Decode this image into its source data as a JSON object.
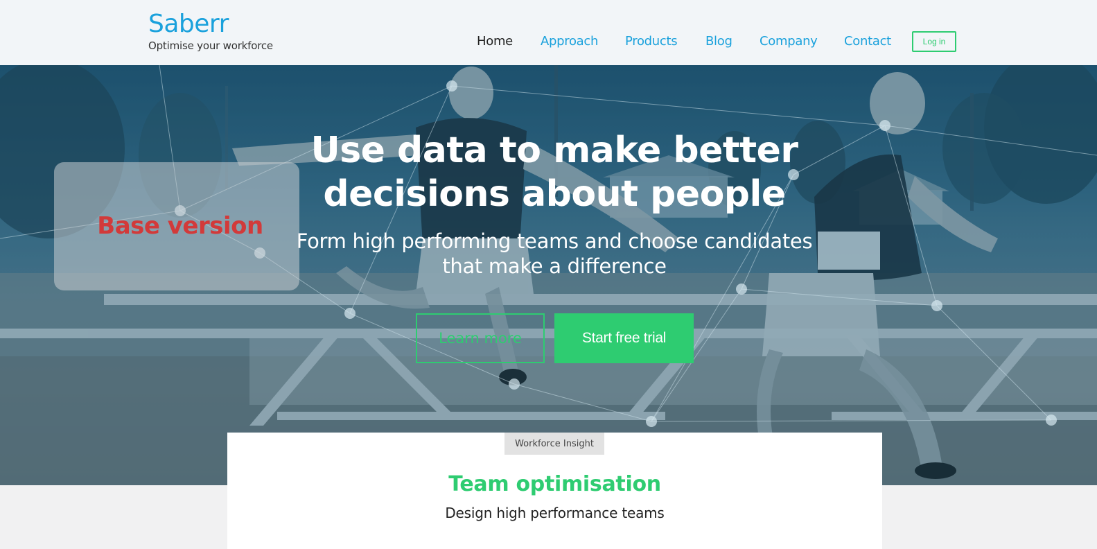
{
  "header": {
    "brand_name": "Saberr",
    "tagline": "Optimise your workforce",
    "nav": [
      {
        "label": "Home",
        "active": true
      },
      {
        "label": "Approach",
        "active": false
      },
      {
        "label": "Products",
        "active": false
      },
      {
        "label": "Blog",
        "active": false
      },
      {
        "label": "Company",
        "active": false
      },
      {
        "label": "Contact",
        "active": false
      }
    ],
    "login_label": "Log in"
  },
  "hero": {
    "overlay_label": "Base version",
    "title_line1": "Use data to make better",
    "title_line2": "decisions about people",
    "subtitle_line1": "Form high performing teams and choose candidates",
    "subtitle_line2": "that make a difference",
    "learn_more_label": "Learn more",
    "start_trial_label": "Start free trial"
  },
  "card": {
    "tab_label": "Workforce Insight",
    "title": "Team optimisation",
    "subtitle": "Design high performance teams"
  },
  "colors": {
    "brand_blue": "#1aa1dc",
    "accent_green": "#2ecc71",
    "overlay_red": "#d23a3a"
  }
}
